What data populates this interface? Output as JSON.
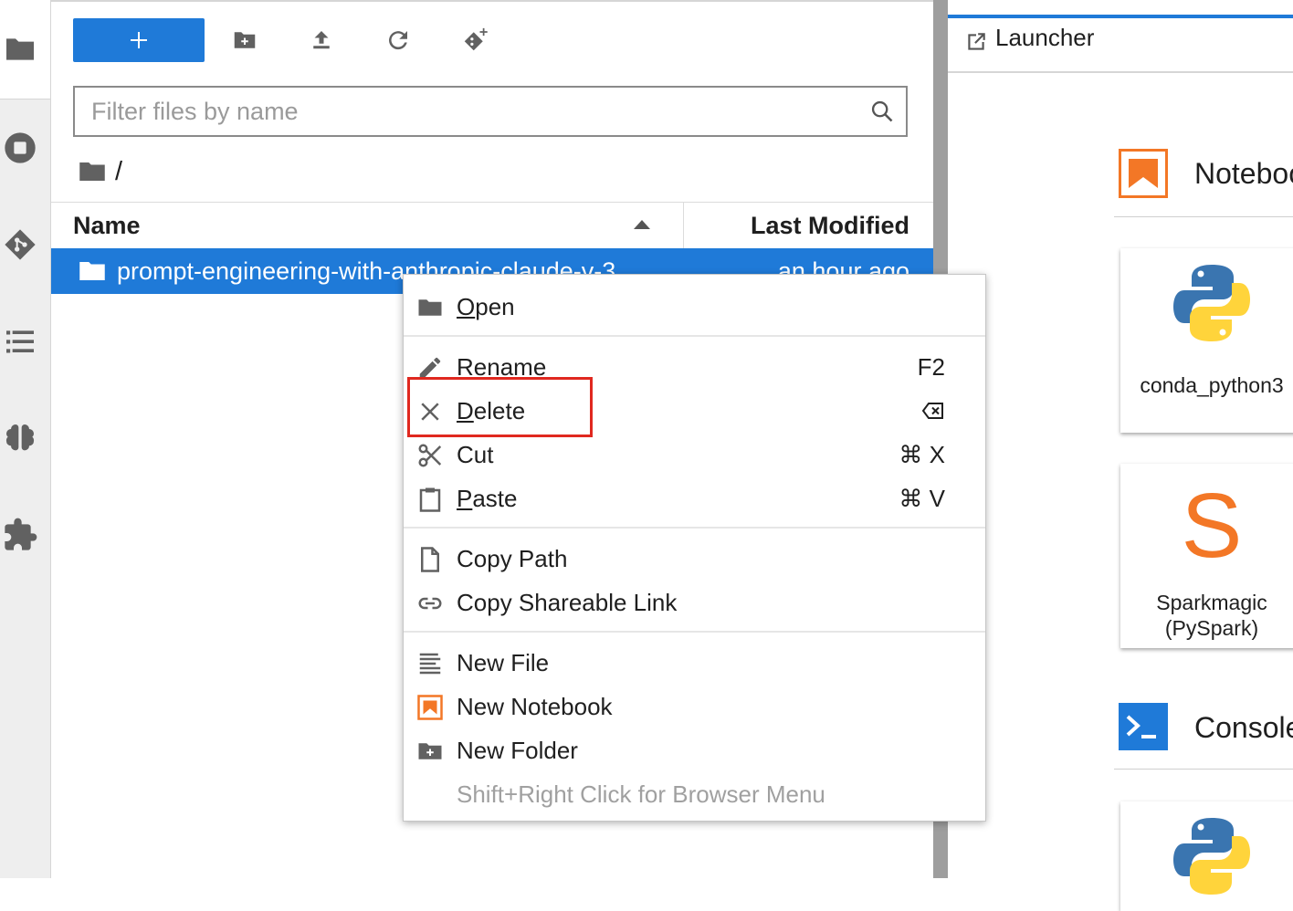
{
  "file_browser": {
    "filter_placeholder": "Filter files by name",
    "breadcrumb_separator": "/",
    "columns": {
      "name": "Name",
      "last_modified": "Last Modified"
    },
    "rows": [
      {
        "name": "prompt-engineering-with-anthropic-claude-v-3",
        "modified": "an hour ago"
      }
    ],
    "toolbar_icons": [
      "plus-icon",
      "new-folder-icon",
      "upload-icon",
      "refresh-icon",
      "git-clone-icon"
    ]
  },
  "activity_bar_icons": [
    "folder-icon",
    "stop-circle-icon",
    "git-icon",
    "toc-icon",
    "brain-icon",
    "extension-puzzle-icon"
  ],
  "context_menu": {
    "open": {
      "label_ul": "O",
      "label_rest": "pen"
    },
    "rename": {
      "label_ul": "R",
      "label_rest": "ename",
      "shortcut": "F2"
    },
    "delete": {
      "label_ul": "D",
      "label_rest": "elete"
    },
    "cut": {
      "label": "Cut",
      "shortcut": "⌘ X"
    },
    "paste": {
      "label_ul": "P",
      "label_rest": "aste",
      "shortcut": "⌘ V"
    },
    "copy_path": {
      "label": "Copy Path"
    },
    "copy_shareable_link": {
      "label": "Copy Shareable Link"
    },
    "new_file": {
      "label": "New File"
    },
    "new_notebook": {
      "label": "New Notebook"
    },
    "new_folder": {
      "label": "New Folder"
    },
    "hint": {
      "label": "Shift+Right Click for Browser Menu"
    }
  },
  "launcher": {
    "tab_label": "Launcher",
    "notebook_section": "Notebook",
    "console_section": "Console",
    "cards": [
      {
        "label": "conda_python3"
      },
      {
        "label_line1": "Sparkmagic",
        "label_line2": "(PySpark)",
        "glyph": "S"
      }
    ]
  },
  "colors": {
    "accent": "#1f7ad8",
    "notebook_orange": "#f37726",
    "highlight_red": "#e0281f",
    "python_blue": "#3a75b0",
    "python_yellow": "#ffd43b"
  }
}
